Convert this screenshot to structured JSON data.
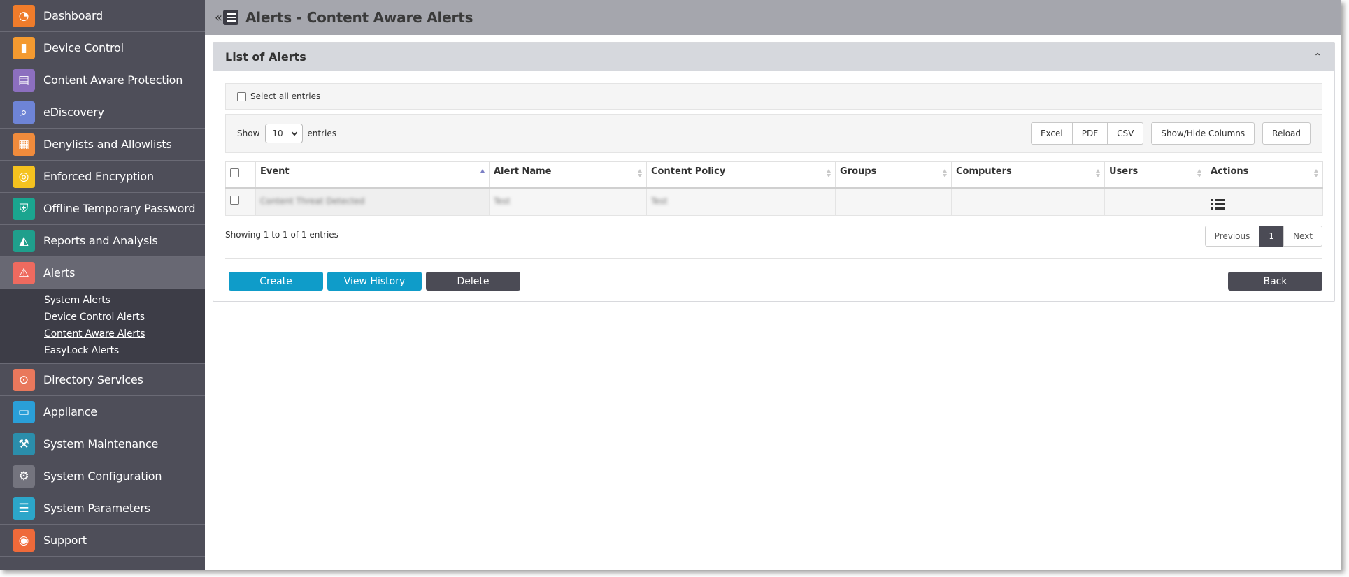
{
  "sidebar": {
    "items": [
      {
        "label": "Dashboard",
        "icon": "dashboard-icon",
        "glyph": "◔",
        "color": "#f07c2b"
      },
      {
        "label": "Device Control",
        "icon": "usb-icon",
        "glyph": "▮",
        "color": "#f49a30"
      },
      {
        "label": "Content Aware Protection",
        "icon": "document-lock-icon",
        "glyph": "▤",
        "color": "#8c6fbf"
      },
      {
        "label": "eDiscovery",
        "icon": "telescope-icon",
        "glyph": "⌕",
        "color": "#6e84d6"
      },
      {
        "label": "Denylists and Allowlists",
        "icon": "list-card-icon",
        "glyph": "▦",
        "color": "#f08b3c"
      },
      {
        "label": "Enforced Encryption",
        "icon": "encryption-icon",
        "glyph": "◎",
        "color": "#f5c21f"
      },
      {
        "label": "Offline Temporary Password",
        "icon": "shield-key-icon",
        "glyph": "⛨",
        "color": "#1aa58f"
      },
      {
        "label": "Reports and Analysis",
        "icon": "chart-icon",
        "glyph": "◭",
        "color": "#1f9f8c"
      },
      {
        "label": "Alerts",
        "icon": "warning-icon",
        "glyph": "⚠",
        "color": "#ee6a5f"
      }
    ],
    "alerts_submenu": [
      {
        "label": "System Alerts"
      },
      {
        "label": "Device Control Alerts"
      },
      {
        "label": "Content Aware Alerts"
      },
      {
        "label": "EasyLock Alerts"
      }
    ],
    "items_after": [
      {
        "label": "Directory Services",
        "icon": "directory-icon",
        "glyph": "⊙",
        "color": "#e9785c"
      },
      {
        "label": "Appliance",
        "icon": "appliance-icon",
        "glyph": "▭",
        "color": "#2a9fd8"
      },
      {
        "label": "System Maintenance",
        "icon": "tools-icon",
        "glyph": "⚒",
        "color": "#2b8eab"
      },
      {
        "label": "System Configuration",
        "icon": "gear-icon",
        "glyph": "⚙",
        "color": "#74747e"
      },
      {
        "label": "System Parameters",
        "icon": "parameters-icon",
        "glyph": "☰",
        "color": "#2ca6c9"
      },
      {
        "label": "Support",
        "icon": "lifebuoy-icon",
        "glyph": "◉",
        "color": "#ef6a3a"
      }
    ]
  },
  "header": {
    "title": "Alerts - Content Aware Alerts",
    "collapse_glyph": "«"
  },
  "panel": {
    "title": "List of Alerts",
    "collapse_glyph": "⌃"
  },
  "select_all": {
    "label": "Select all entries"
  },
  "toolbar": {
    "show_label": "Show",
    "length_value": "10",
    "entries_label": "entries",
    "export_buttons": [
      "Excel",
      "PDF",
      "CSV"
    ],
    "show_hide_label": "Show/Hide Columns",
    "reload_label": "Reload"
  },
  "table": {
    "columns": [
      "Event",
      "Alert Name",
      "Content Policy",
      "Groups",
      "Computers",
      "Users",
      "Actions"
    ],
    "rows": [
      {
        "event": "Content Threat Detected",
        "alert_name": "Test",
        "content_policy": "Test",
        "groups": "",
        "computers": "",
        "users": ""
      }
    ]
  },
  "info": "Showing 1 to 1 of 1 entries",
  "pagination": {
    "previous": "Previous",
    "current": "1",
    "next": "Next"
  },
  "actions": {
    "create": "Create",
    "view_history": "View History",
    "delete": "Delete",
    "back": "Back"
  }
}
